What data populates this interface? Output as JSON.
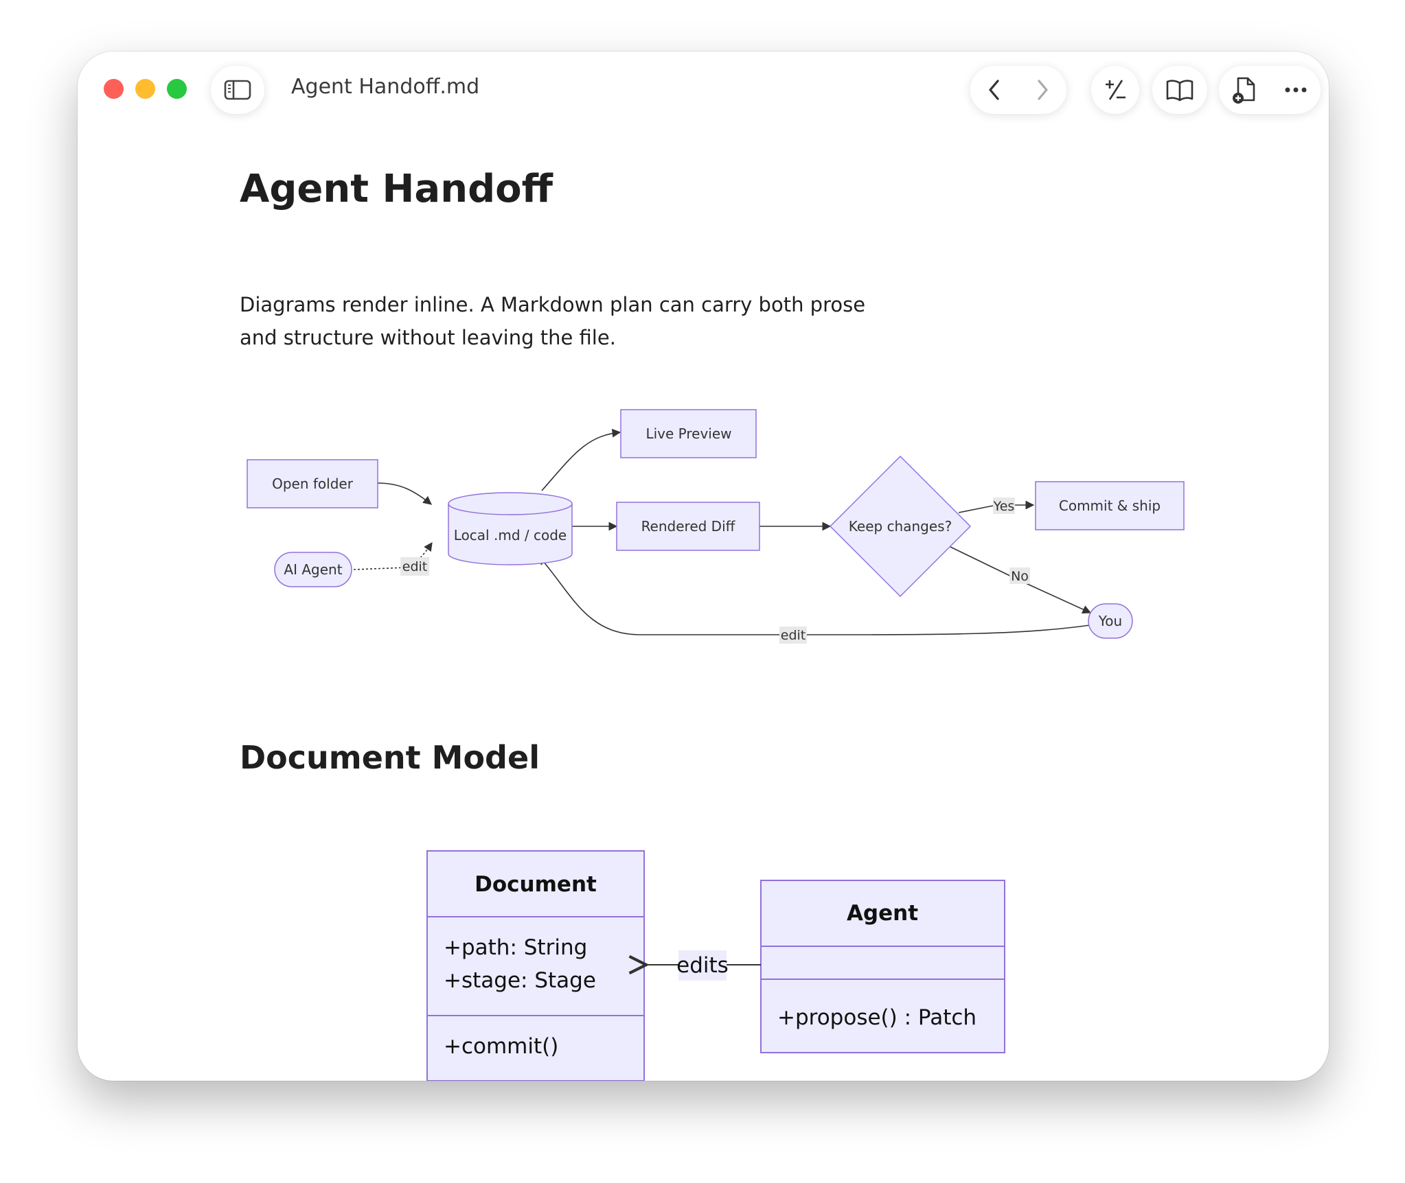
{
  "window": {
    "title": "Agent Handoff.md",
    "traffic_colors": {
      "close": "#fe5f57",
      "minimize": "#febc2e",
      "zoom": "#28c840"
    }
  },
  "toolbar": {
    "sidebar_icon": "sidebar-icon",
    "back_icon": "chevron-left-icon",
    "forward_icon": "chevron-right-icon",
    "diff_icon": "plus-minus-icon",
    "reader_icon": "book-icon",
    "new_doc_icon": "new-document-icon",
    "more_icon": "ellipsis-icon"
  },
  "doc": {
    "title": "Agent Handoff",
    "intro": "Diagrams render inline. A Markdown plan can carry both prose and structure without leaving the file.",
    "section2_title": "Document Model"
  },
  "flowchart": {
    "node_fill": "#ececfe",
    "node_stroke": "#9370db",
    "nodes": {
      "open_folder": "Open folder",
      "ai_agent": "AI Agent",
      "local_code": "Local .md / code",
      "live_preview": "Live Preview",
      "rendered_diff": "Rendered Diff",
      "keep_changes": "Keep changes?",
      "commit_ship": "Commit & ship",
      "you": "You"
    },
    "edge_labels": {
      "agent_edit": "edit",
      "yes": "Yes",
      "no": "No",
      "you_edit": "edit"
    }
  },
  "class_diagram": {
    "document": {
      "name": "Document",
      "attributes": [
        "+path: String",
        "+stage: Stage"
      ],
      "methods": [
        "+commit()"
      ]
    },
    "agent": {
      "name": "Agent",
      "attributes": [],
      "methods": [
        "+propose() : Patch"
      ]
    },
    "relation_label": "edits"
  }
}
